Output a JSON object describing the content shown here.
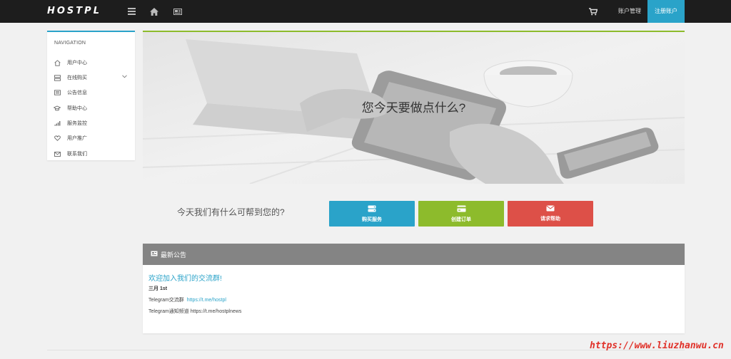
{
  "topbar": {
    "logo": "HOSTPL",
    "account_link": "账户管理",
    "register_button": "注册账户"
  },
  "sidebar": {
    "title": "NAVIGATION",
    "items": [
      {
        "label": "用户中心",
        "icon": "home-icon"
      },
      {
        "label": "在线购买",
        "icon": "server-icon"
      },
      {
        "label": "公告信息",
        "icon": "newspaper-icon"
      },
      {
        "label": "帮助中心",
        "icon": "graduation-cap-icon"
      },
      {
        "label": "服务监控",
        "icon": "signal-icon"
      },
      {
        "label": "用户推广",
        "icon": "heart-icon"
      },
      {
        "label": "联系我们",
        "icon": "envelope-icon"
      }
    ]
  },
  "hero": {
    "title": "您今天要做点什么?"
  },
  "help": {
    "prompt": "今天我们有什么可帮到您的?",
    "buttons": [
      {
        "label": "购买服务",
        "icon": "server-icon",
        "color": "#2aa3c9"
      },
      {
        "label": "创建订单",
        "icon": "credit-card-icon",
        "color": "#8dbb2c"
      },
      {
        "label": "请求帮助",
        "icon": "envelope-icon",
        "color": "#dd5048"
      }
    ]
  },
  "announcements": {
    "header": "最新公告",
    "title": "欢迎加入我们的交流群!",
    "date": "三月 1st",
    "lines": [
      {
        "text": "Telegram交流群",
        "link": "https://t.me/hostpl"
      },
      {
        "text": "Telegram通知频道 https://t.me/hostplnews",
        "link": ""
      }
    ]
  },
  "watermark": "https://www.liuzhanwu.cn",
  "colors": {
    "accent_blue": "#2aa3c9",
    "accent_green": "#8dbb2c",
    "accent_red": "#dd5048",
    "topbar": "#1d1d1d"
  }
}
